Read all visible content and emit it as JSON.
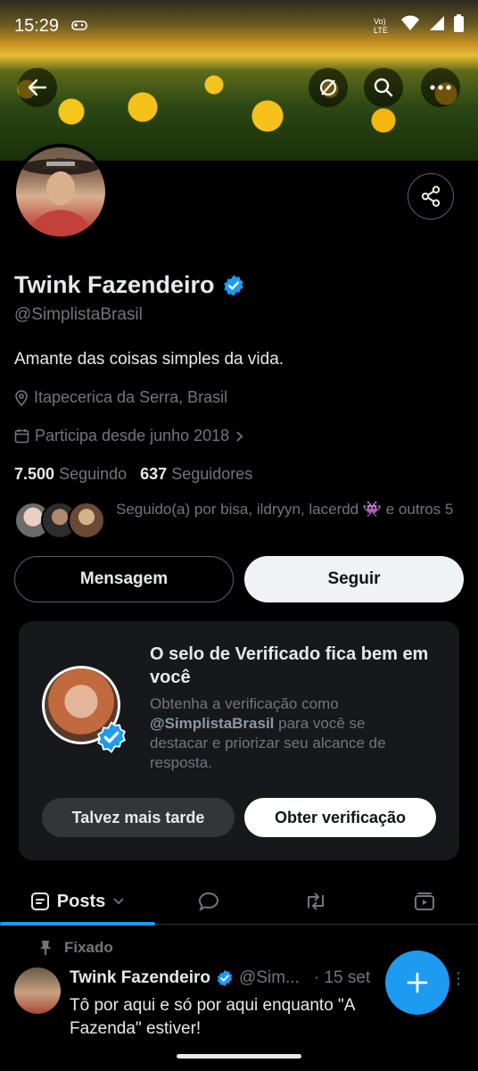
{
  "status_bar": {
    "time": "15:29",
    "network": "Vo) LTE"
  },
  "header": {
    "back_icon": "arrow-left-icon",
    "icons": [
      "refresh-icon",
      "search-icon",
      "more-icon"
    ]
  },
  "profile": {
    "display_name": "Twink Fazendeiro",
    "handle": "@SimplistaBrasil",
    "bio": "Amante das coisas simples da vida.",
    "location": "Itapecerica da Serra, Brasil",
    "joined": "Participa desde junho 2018",
    "following_count": "7.500",
    "following_label": "Seguindo",
    "followers_count": "637",
    "followers_label": "Seguidores",
    "followed_by": "Seguido(a) por bisa, ildryyn, lacerdd 👾 e outros 5",
    "verified_color": "#1d9bf0"
  },
  "actions": {
    "message_label": "Mensagem",
    "follow_label": "Seguir"
  },
  "verification_card": {
    "title": "O selo de Verificado fica bem em você",
    "desc_prefix": "Obtenha a verificação como",
    "desc_handle": "@SimplistaBrasil",
    "desc_suffix": "para você se destacar e priorizar seu alcance de resposta.",
    "later_label": "Talvez mais tarde",
    "get_label": "Obter verificação"
  },
  "tabs": {
    "posts_label": "Posts"
  },
  "pinned_post": {
    "pinned_label": "Fixado",
    "author": "Twink Fazendeiro",
    "handle": "@Sim...",
    "date": "· 15 set",
    "text": "Tô por aqui e só por aqui enquanto \"A Fazenda\" estiver!"
  }
}
